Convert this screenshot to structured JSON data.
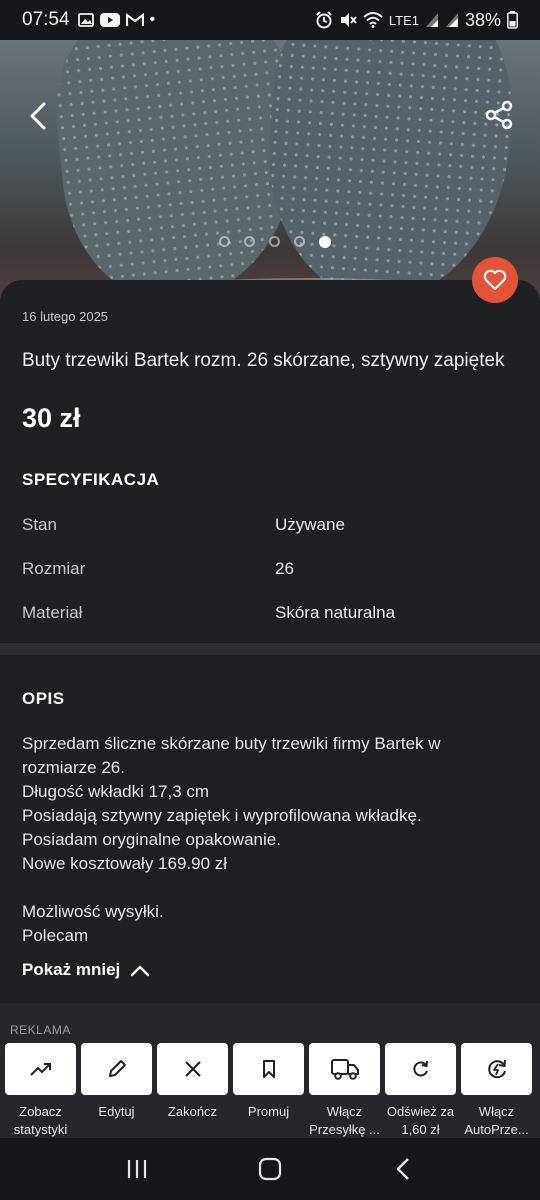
{
  "status": {
    "time": "07:54",
    "dot": "•",
    "lte": "LTE1",
    "battery": "38%"
  },
  "listing": {
    "date": "16 lutego 2025",
    "title": "Buty trzewiki Bartek rozm. 26 skórzane, sztywny zapiętek",
    "price": "30 zł"
  },
  "gallery": {
    "count": 5,
    "active_index": 4
  },
  "spec": {
    "heading": "SPECYFIKACJA",
    "rows": [
      {
        "key": "Stan",
        "value": "Używane"
      },
      {
        "key": "Rozmiar",
        "value": "26"
      },
      {
        "key": "Materiał",
        "value": "Skóra naturalna"
      }
    ]
  },
  "description": {
    "heading": "OPIS",
    "text": "Sprzedam śliczne skórzane buty trzewiki firmy Bartek w rozmiarze 26.\nDługość wkładki 17,3 cm\nPosiadają sztywny zapiętek i wyprofilowana wkładkę.\nPosiadam oryginalne opakowanie.\nNowe kosztowały 169.90 zł\n\nMożliwość wysyłki.\nPolecam",
    "toggle_label": "Pokaż mniej"
  },
  "ad_label": "REKLAMA",
  "actions": [
    {
      "label": "Zobacz statystyki",
      "icon": "trend-icon"
    },
    {
      "label": "Edytuj",
      "icon": "pencil-icon"
    },
    {
      "label": "Zakończ",
      "icon": "close-icon"
    },
    {
      "label": "Promuj",
      "icon": "bookmark-icon"
    },
    {
      "label": "Włącz Przesyłkę ...",
      "icon": "truck-icon"
    },
    {
      "label": "Odśwież za 1,60 zł",
      "icon": "refresh-icon"
    },
    {
      "label": "Włącz AutoPrze...",
      "icon": "auto-refresh-icon"
    }
  ],
  "colors": {
    "accent": "#e2533a",
    "background": "#181a1f",
    "card": "#1e2024"
  }
}
